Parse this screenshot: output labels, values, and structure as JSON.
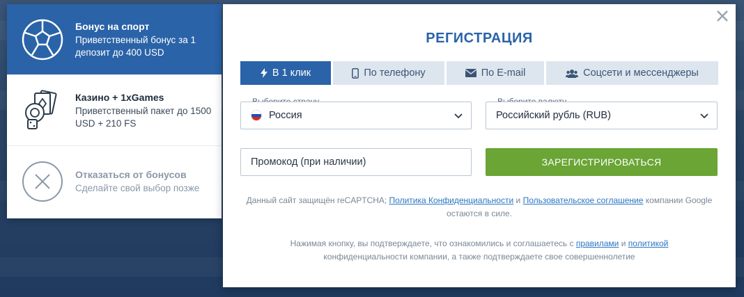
{
  "bonuses": [
    {
      "title": "Бонус на спорт",
      "desc": "Приветственный бонус за 1 депозит до 400 USD",
      "icon": "soccer-ball-icon"
    },
    {
      "title": "Казино + 1xGames",
      "desc": "Приветственный пакет до 1500 USD + 210 FS",
      "icon": "casino-chips-cards-icon"
    },
    {
      "title": "Отказаться от бонусов",
      "desc": "Сделайте свой выбор позже",
      "icon": "decline-x-icon"
    }
  ],
  "modal": {
    "title": "РЕГИСТРАЦИЯ",
    "tabs": [
      {
        "label": "В 1 клик",
        "icon": "lightning-icon"
      },
      {
        "label": "По телефону",
        "icon": "phone-icon"
      },
      {
        "label": "По E-mail",
        "icon": "envelope-icon"
      },
      {
        "label": "Соцсети и мессенджеры",
        "icon": "users-icon"
      }
    ],
    "country": {
      "label": "Выберите страну",
      "value": "Россия"
    },
    "currency": {
      "label": "Выберите валюту",
      "value": "Российский рубль (RUB)"
    },
    "promo": {
      "placeholder": "Промокод (при наличии)"
    },
    "register_label": "ЗАРЕГИСТРИРОВАТЬСЯ",
    "recaptcha": {
      "prefix": "Данный сайт защищён reCAPTCHA;",
      "privacy_link": "Политика Конфиденциальности",
      "and": "и",
      "terms_link": "Пользовательское соглашение",
      "suffix": "компании Google остаются в силе."
    },
    "consent": {
      "prefix": "Нажимая кнопку, вы подтверждаете, что ознакомились и соглашаетесь с",
      "rules_link": "правилами",
      "and": "и",
      "policy_link": "политикой",
      "suffix": "конфиденциальности компании, а также подтверждаете свое совершеннолетие"
    }
  },
  "colors": {
    "accent": "#2a63a8",
    "register": "#6aa535",
    "link": "#2a76c2"
  }
}
